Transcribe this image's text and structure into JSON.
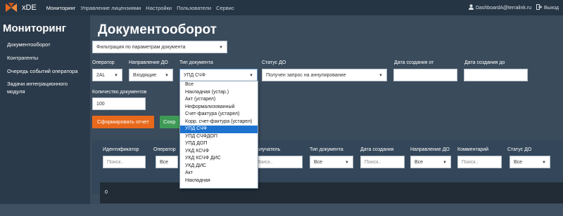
{
  "navbar": {
    "brand": "xDE",
    "items": [
      {
        "label": "Мониторинг",
        "active": true
      },
      {
        "label": "Управление лицензиями",
        "active": false
      },
      {
        "label": "Настройки",
        "active": false
      },
      {
        "label": "Пользователи",
        "active": false
      },
      {
        "label": "Сервис",
        "active": false
      }
    ],
    "user": "DashboardA@terralink.ru",
    "logout": "Выход",
    "accent": "#e8691c"
  },
  "sidebar": {
    "title": "Мониторинг",
    "items": [
      {
        "label": "Документооборот"
      },
      {
        "label": "Контрагенты"
      },
      {
        "label": "Очередь событий оператора"
      },
      {
        "label": "Задачи интеграционного модуля"
      }
    ]
  },
  "main": {
    "title": "Документооборот",
    "filter_select": "Фильтрация по параметрам документа",
    "filters": {
      "operator": {
        "label": "Оператор",
        "value": "2AL"
      },
      "direction": {
        "label": "Направление ДО",
        "value": "Входящие"
      },
      "doc_type": {
        "label": "Тип документа",
        "value": "УПД СЧФ"
      },
      "status": {
        "label": "Статус ДО",
        "value": "Получен запрос на аннулирование"
      },
      "date_from": {
        "label": "Дата создания от",
        "value": ""
      },
      "date_to": {
        "label": "Дата создания до",
        "value": ""
      },
      "count": {
        "label": "Количество документов",
        "value": "100"
      }
    },
    "buttons": {
      "report": "Сформировать отчет",
      "save": "Сохр"
    }
  },
  "dropdown": {
    "options": [
      "Все",
      "Накладная (устар.)",
      "Акт (устарел)",
      "Неформализованный",
      "Счет-фактура (устарел)",
      "Корр. счет-фактура (устарел)",
      "УПД СЧФ",
      "УПД СЧФДОП",
      "УПД ДОП",
      "УКД КСЧФ",
      "УКД КСЧФ ДИС",
      "УКД ДИС",
      "Акт",
      "Накладная"
    ],
    "selected": "УПД СЧФ"
  },
  "table": {
    "columns": {
      "identifier": {
        "label": "Идентификатор",
        "placeholder": "Поиск.."
      },
      "operator": {
        "label": "Оператор",
        "value": "Все"
      },
      "recipient": {
        "label": "олучатель",
        "placeholder": "Поиск.."
      },
      "doc_type": {
        "label": "Тип документа",
        "value": "Все"
      },
      "created": {
        "label": "Дата создания",
        "placeholder": "Поиск.."
      },
      "direction": {
        "label": "Направление ДО",
        "value": "Все"
      },
      "comment": {
        "label": "Комментарий",
        "placeholder": "Поиск.."
      },
      "status": {
        "label": "Статус ДО",
        "value": "Все"
      }
    },
    "rows": [
      {
        "cell": "0"
      }
    ]
  }
}
